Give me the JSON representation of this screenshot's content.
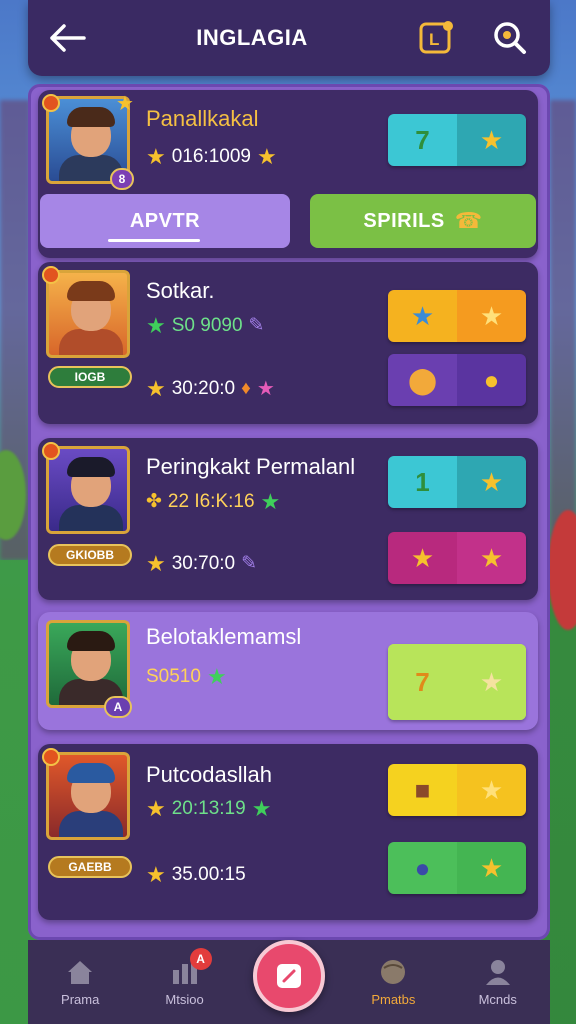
{
  "header": {
    "title": "INGLAGIA",
    "back_icon": "back-arrow-icon",
    "badge_icon": "league-badge-icon",
    "badge_letter": "L",
    "search_icon": "search-icon"
  },
  "top_player": {
    "name": "Panallkakal",
    "stat": "016:1009",
    "level": "8",
    "score_left": "7",
    "score_right": "★"
  },
  "tabs": [
    {
      "label": "APVTR",
      "active": true
    },
    {
      "label": "SPIRILS",
      "active": false
    }
  ],
  "players": [
    {
      "name": "Sotkar.",
      "stat1": "S0 9090",
      "stat2": "30:20:0",
      "badge": "IOGB"
    },
    {
      "name": "Peringkakt Permalanl",
      "stat1": "22 I6:K:16",
      "stat2": "30:70:0",
      "badge": "GKIOBB"
    },
    {
      "name": "Belotaklemamsl",
      "stat1": "S0510",
      "stat2": "",
      "badge": "A",
      "score_left": "7"
    },
    {
      "name": "Putcodasllah",
      "stat1": "20:13:19",
      "stat2": "35.00:15",
      "badge": "GAEBB"
    }
  ],
  "bottom_nav": [
    {
      "label": "Prama",
      "icon": "home-icon"
    },
    {
      "label": "Mtsioo",
      "icon": "stats-icon",
      "notification": "A"
    },
    {
      "label": "",
      "icon": "edit-icon"
    },
    {
      "label": "Pmatbs",
      "icon": "ball-icon"
    },
    {
      "label": "Mcnds",
      "icon": "profile-icon"
    }
  ],
  "colors": {
    "panel": "#8a62cc",
    "card": "#3d2b63",
    "accent_gold": "#f6c12d",
    "accent_green": "#3fcf5b"
  }
}
